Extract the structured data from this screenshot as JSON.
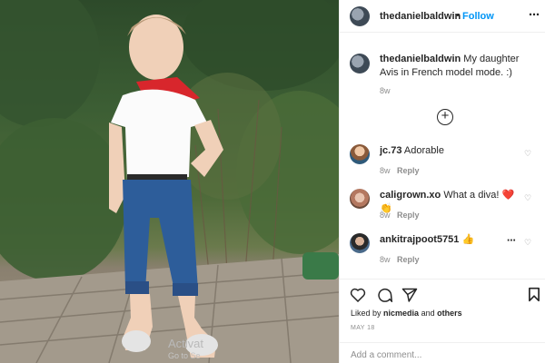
{
  "post": {
    "author": "thedanielbaldwin",
    "follow_label": "Follow",
    "separator": "•",
    "more_icon": "⋯",
    "caption_user": "thedanielbaldwin",
    "caption_text": "My daughter Avis in French model mode. :)",
    "caption_age": "8w",
    "load_more_icon": "plus-circle-icon"
  },
  "comments": [
    {
      "user": "jc.73",
      "text": "Adorable",
      "age": "8w",
      "reply_label": "Reply",
      "avatar": "avatar-icon"
    },
    {
      "user": "caligrown.xo",
      "text": "What a diva!",
      "emoji": "❤️👏",
      "age": "8w",
      "reply_label": "Reply",
      "avatar": "avatar-icon"
    },
    {
      "user": "ankitrajpoot5751",
      "emoji": "👍",
      "age": "8w",
      "reply_label": "Reply",
      "avatar": "avatar-icon",
      "more": "⋯"
    }
  ],
  "footer": {
    "liked_by_prefix": "Liked by",
    "liked_by_user": "nicmedia",
    "liked_by_join": "and",
    "liked_by_others": "others",
    "date": "MAY 18",
    "add_comment_placeholder": "Add a comment..."
  },
  "watermark": {
    "line1": "Activat",
    "line2": "Go to Se"
  },
  "colors": {
    "link": "#0095f6",
    "text": "#262626",
    "muted": "#8e8e8e",
    "border": "#efefef"
  }
}
